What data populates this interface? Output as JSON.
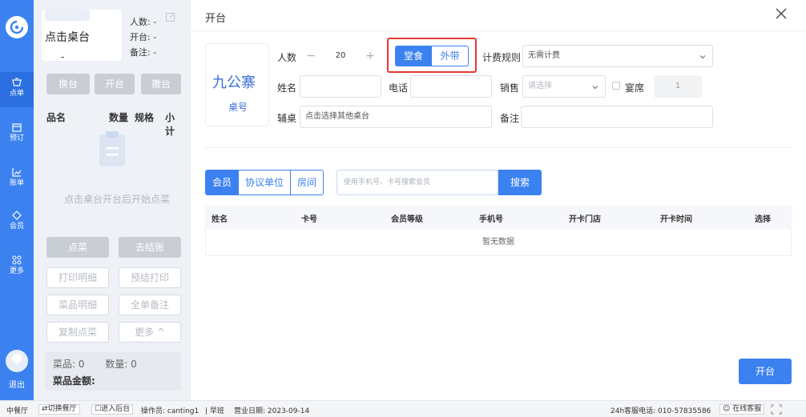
{
  "nav": {
    "items": [
      {
        "label": "点单",
        "icon": "cup-icon"
      },
      {
        "label": "预订",
        "icon": "calendar-icon"
      },
      {
        "label": "账单",
        "icon": "chart-icon"
      },
      {
        "label": "会员",
        "icon": "diamond-icon"
      },
      {
        "label": "更多",
        "icon": "grid-icon"
      }
    ],
    "logout": "退出"
  },
  "panel": {
    "table_name": "点击桌台",
    "table_dash": "-",
    "people": "人数: -",
    "opened": "开台: -",
    "note": "备注: -",
    "actions": {
      "change": "换台",
      "open": "开台",
      "cancel": "撤台"
    },
    "columns": {
      "name": "品名",
      "qty": "数量",
      "spec": "规格",
      "subtotal": "小计"
    },
    "empty_text": "点击桌台开台后开始点菜",
    "order_btn": "点菜",
    "checkout_btn": "去结账",
    "print_detail": "打印明细",
    "pre_print": "预结打印",
    "dish_detail": "菜品明细",
    "order_note": "全单备注",
    "copy_order": "复制点菜",
    "more": "更多 ^",
    "summary_items": "菜品: 0",
    "summary_qty": "数量: 0",
    "summary_amount": "菜品金额:"
  },
  "main": {
    "title": "开台",
    "brand": "九公寨",
    "table_no_label": "桌号",
    "people_label": "人数",
    "people_value": "20",
    "minus": "−",
    "plus": "+",
    "dine_in": "堂食",
    "takeaway": "外带",
    "billing_rule_label": "计费规则",
    "billing_rule_value": "无需计费",
    "name_label": "姓名",
    "phone_label": "电话",
    "sales_label": "销售",
    "sales_placeholder": "请选择",
    "banquet_label": "宴席",
    "banquet_value": "1",
    "aux_table_label": "辅桌",
    "aux_table_placeholder": "点击选择其他桌台",
    "remark_label": "备注",
    "tabs": [
      "会员",
      "协议单位",
      "房间"
    ],
    "search_placeholder": "使用手机号、卡号搜索会员",
    "search_btn": "搜索",
    "columns": [
      "姓名",
      "卡号",
      "会员等级",
      "手机号",
      "开卡门店",
      "开卡时间",
      "选择"
    ],
    "empty_text": "暂无数据",
    "open_btn": "开台"
  },
  "status": {
    "restaurant": "中餐厅",
    "switch": "⇄切换餐厅",
    "backend": "☐进入后台",
    "operator": "操作员: canting1",
    "shift": "| 早班",
    "business_date": "营业日期: 2023-09-14",
    "hotline": "24h客服电话: 010-57835586",
    "online_service": "在线客服"
  },
  "colors": {
    "primary": "#3b82f0",
    "highlight": "#e53935"
  }
}
